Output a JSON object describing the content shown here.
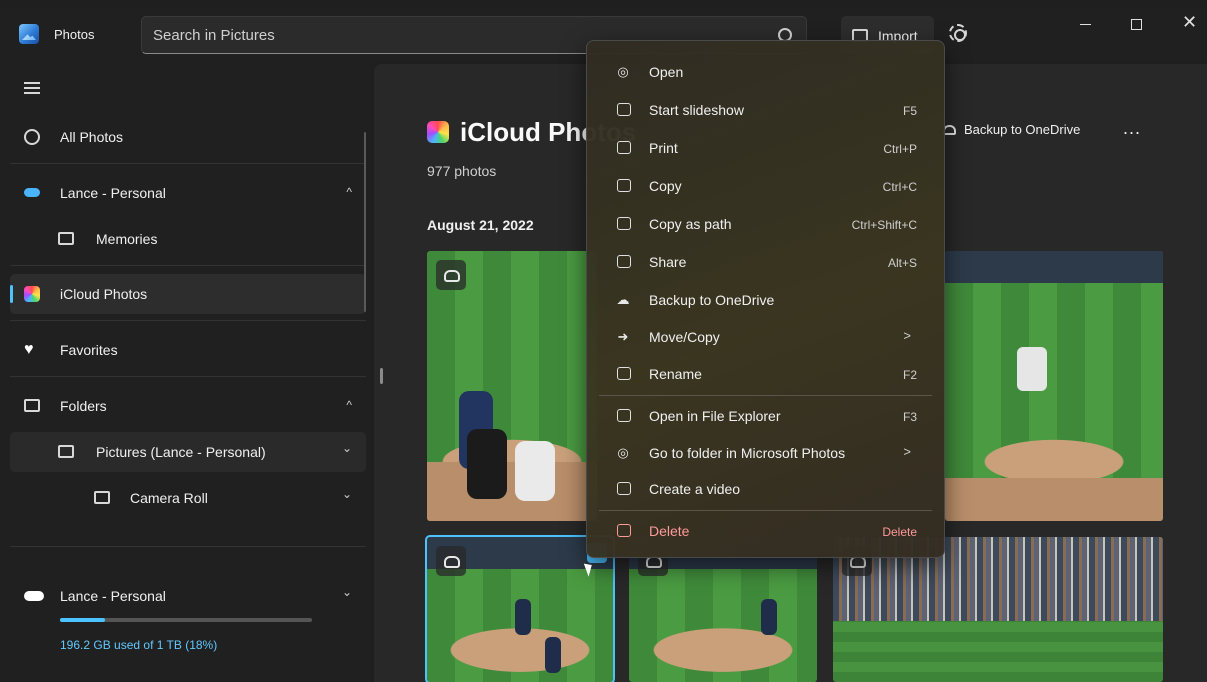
{
  "titlebar": {
    "app_name": "Photos",
    "search_placeholder": "Search in Pictures",
    "import_label": "Import"
  },
  "sidebar": {
    "all_photos": "All Photos",
    "onedrive_account": "Lance - Personal",
    "memories": "Memories",
    "icloud": "iCloud Photos",
    "favorites": "Favorites",
    "folders": "Folders",
    "pictures_folder": "Pictures (Lance - Personal)",
    "camera_roll": "Camera Roll",
    "footer_account": "Lance - Personal",
    "storage_text": "196.2 GB used of 1 TB (18%)",
    "storage_fraction": 0.18,
    "chevron_up": "^",
    "chevron_down": "⌄"
  },
  "main": {
    "title": "iCloud Photos",
    "photo_count": "977 photos",
    "date_header": "August 21, 2022",
    "backup_label": "Backup to OneDrive",
    "more_label": "..."
  },
  "context_menu": {
    "items": [
      {
        "label": "Open",
        "shortcut": ""
      },
      {
        "label": "Start slideshow",
        "shortcut": "F5"
      },
      {
        "label": "Print",
        "shortcut": "Ctrl+P"
      },
      {
        "label": "Copy",
        "shortcut": "Ctrl+C"
      },
      {
        "label": "Copy as path",
        "shortcut": "Ctrl+Shift+C"
      },
      {
        "label": "Share",
        "shortcut": "Alt+S"
      },
      {
        "label": "Backup to OneDrive",
        "shortcut": ""
      },
      {
        "label": "Move/Copy",
        "shortcut": ">"
      },
      {
        "label": "Rename",
        "shortcut": "F2"
      },
      {
        "label": "Open in File Explorer",
        "shortcut": "F3"
      },
      {
        "label": "Go to folder in Microsoft Photos",
        "shortcut": ">"
      },
      {
        "label": "Create a video",
        "shortcut": ""
      },
      {
        "label": "Delete",
        "shortcut": "Delete"
      }
    ]
  },
  "colors": {
    "accent": "#4cc2ff",
    "danger": "#ff9a9a",
    "background": "#202020"
  }
}
